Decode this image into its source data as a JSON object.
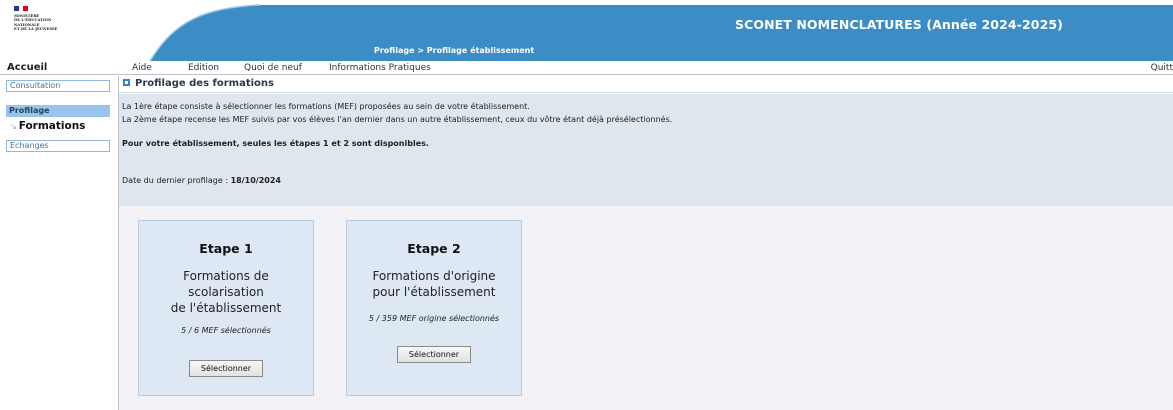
{
  "header": {
    "logo_lines": [
      "Ministère",
      "de l'Éducation",
      "nationale",
      "et de la Jeunesse"
    ],
    "app_title": "SCONET NOMENCLATURES (Année 2024-2025)",
    "breadcrumb": "Profilage > Profilage établissement",
    "band_color": "#3c8dc5"
  },
  "menu": {
    "home": "Accueil",
    "items": [
      "Aide",
      "Edition",
      "Quoi de neuf",
      "Informations Pratiques"
    ],
    "quit": "Quitt"
  },
  "sidebar": {
    "consultation": "Consultation",
    "profilage": "Profilage",
    "formations": "Formations",
    "echanges": "Echanges"
  },
  "main": {
    "section_title": "Profilage des formations",
    "line1": "La 1ère étape consiste à sélectionner les formations (MEF) proposées au sein de votre établissement.",
    "line2": "La 2ème étape recense les MEF suivis par vos élèves l'an dernier dans un autre établissement, ceux du vôtre étant déjà présélectionnés.",
    "line3": "Pour votre établissement, seules les étapes 1 et 2 sont disponibles.",
    "last_date_label": "Date du dernier profilage : ",
    "last_date_value": "18/10/2024"
  },
  "steps": [
    {
      "title": "Etape 1",
      "subtitle_lines": [
        "Formations de",
        "scolarisation",
        "de l'établissement"
      ],
      "count": "5 / 6 MEF sélectionnés",
      "button": "Sélectionner"
    },
    {
      "title": "Etape 2",
      "subtitle_lines": [
        "Formations d'origine",
        "pour l'établissement"
      ],
      "count": "5 / 359 MEF origine sélectionnés",
      "button": "Sélectionner"
    }
  ]
}
